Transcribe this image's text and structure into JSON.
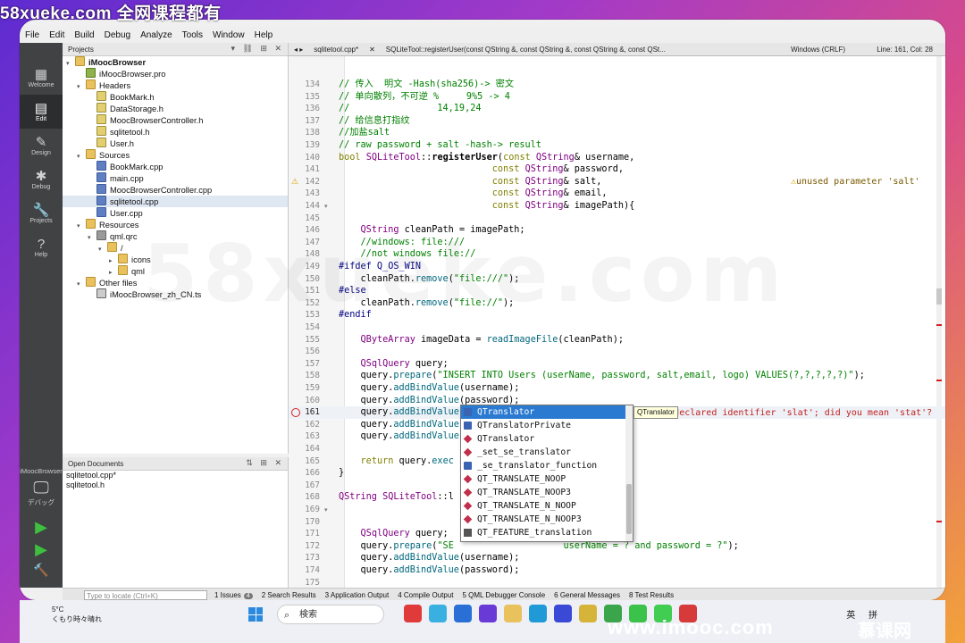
{
  "window": {
    "title": "sqlitetool.cpp @ iMoocBrowser - Qt Creator"
  },
  "watermarks": {
    "top_left": "58xueke.com  全网课程都有",
    "center": "58xueke.com",
    "bottom_right": "www.imooc.com",
    "bottom_right2": "慕课网"
  },
  "menu": [
    "File",
    "Edit",
    "Build",
    "Debug",
    "Analyze",
    "Tools",
    "Window",
    "Help"
  ],
  "modes": [
    {
      "label": "Welcome",
      "icon": "grid-icon"
    },
    {
      "label": "Edit",
      "icon": "edit-icon"
    },
    {
      "label": "Design",
      "icon": "pencil-icon"
    },
    {
      "label": "Debug",
      "icon": "bug-icon"
    },
    {
      "label": "Projects",
      "icon": "wrench-icon"
    },
    {
      "label": "Help",
      "icon": "help-icon"
    }
  ],
  "project_pane": {
    "title": "Projects",
    "tree": [
      {
        "label": "iMoocBrowser",
        "depth": 0,
        "icon": "project",
        "arrow": "▾",
        "bold": true
      },
      {
        "label": "iMoocBrowser.pro",
        "depth": 1,
        "icon": "pro",
        "arrow": ""
      },
      {
        "label": "Headers",
        "depth": 1,
        "icon": "folder",
        "arrow": "▾"
      },
      {
        "label": "BookMark.h",
        "depth": 2,
        "icon": "h",
        "arrow": ""
      },
      {
        "label": "DataStorage.h",
        "depth": 2,
        "icon": "h",
        "arrow": ""
      },
      {
        "label": "MoocBrowserController.h",
        "depth": 2,
        "icon": "h",
        "arrow": ""
      },
      {
        "label": "sqlitetool.h",
        "depth": 2,
        "icon": "h",
        "arrow": ""
      },
      {
        "label": "User.h",
        "depth": 2,
        "icon": "h",
        "arrow": ""
      },
      {
        "label": "Sources",
        "depth": 1,
        "icon": "folder",
        "arrow": "▾"
      },
      {
        "label": "BookMark.cpp",
        "depth": 2,
        "icon": "cpp",
        "arrow": ""
      },
      {
        "label": "main.cpp",
        "depth": 2,
        "icon": "cpp",
        "arrow": ""
      },
      {
        "label": "MoocBrowserController.cpp",
        "depth": 2,
        "icon": "cpp",
        "arrow": ""
      },
      {
        "label": "sqlitetool.cpp",
        "depth": 2,
        "icon": "cpp",
        "arrow": "",
        "selected": true
      },
      {
        "label": "User.cpp",
        "depth": 2,
        "icon": "cpp",
        "arrow": ""
      },
      {
        "label": "Resources",
        "depth": 1,
        "icon": "folder",
        "arrow": "▾"
      },
      {
        "label": "qml.qrc",
        "depth": 2,
        "icon": "qrc",
        "arrow": "▾"
      },
      {
        "label": "/",
        "depth": 3,
        "icon": "folder",
        "arrow": "▾"
      },
      {
        "label": "icons",
        "depth": 4,
        "icon": "folder",
        "arrow": "▸"
      },
      {
        "label": "qml",
        "depth": 4,
        "icon": "folder",
        "arrow": "▸"
      },
      {
        "label": "Other files",
        "depth": 1,
        "icon": "folder",
        "arrow": "▾"
      },
      {
        "label": "iMoocBrowser_zh_CN.ts",
        "depth": 2,
        "icon": "ts",
        "arrow": ""
      }
    ]
  },
  "open_docs": {
    "title": "Open Documents",
    "items": [
      "sqlitetool.cpp*",
      "sqlitetool.h"
    ]
  },
  "session": {
    "name": "iMoocBrowser",
    "kit_label": "デバッグ"
  },
  "editor_header": {
    "file_tab": "sqlitetool.cpp*",
    "symbol": "SQLiteTool::registerUser(const QString &, const QString &, const QString &, const QSt...",
    "encoding": "Windows (CRLF)",
    "position": "Line: 161, Col: 28"
  },
  "code": [
    {
      "n": 134,
      "html": "<span class='cm'>// 传入  明文 -Hash(sha256)-> 密文</span>"
    },
    {
      "n": 135,
      "html": "<span class='cm'>// 单向散列，不可逆 %     9%5 -> 4</span>"
    },
    {
      "n": 136,
      "html": "<span class='cm'>//                14,19,24</span>"
    },
    {
      "n": 137,
      "html": "<span class='cm'>// 给信息打指纹</span>"
    },
    {
      "n": 138,
      "html": "<span class='cm'>//加盐salt</span>"
    },
    {
      "n": 139,
      "html": "<span class='cm'>// raw password + salt -hash-> result</span>"
    },
    {
      "n": 140,
      "html": "<span class='kw'>bool</span> <span class='ty'>SQLiteTool</span>::<span class='bold'>registerUser</span>(<span class='kw'>const</span> <span class='ty'>QString</span>&amp; username,"
    },
    {
      "n": 141,
      "html": "                            <span class='kw'>const</span> <span class='ty'>QString</span>&amp; password,"
    },
    {
      "n": 142,
      "html": "                            <span class='kw'>const</span> <span class='ty'>QString</span>&amp; salt,",
      "warn": true
    },
    {
      "n": 143,
      "html": "                            <span class='kw'>const</span> <span class='ty'>QString</span>&amp; email,"
    },
    {
      "n": 144,
      "html": "                            <span class='kw'>const</span> <span class='ty'>QString</span>&amp; imagePath){",
      "fold": true
    },
    {
      "n": 145,
      "html": ""
    },
    {
      "n": 146,
      "html": "    <span class='ty'>QString</span> cleanPath = imagePath;"
    },
    {
      "n": 147,
      "html": "    <span class='cm'>//windows: file:///</span>"
    },
    {
      "n": 148,
      "html": "    <span class='cm'>//not windows file://</span>"
    },
    {
      "n": 149,
      "html": "<span class='pp'>#ifdef Q_OS_WIN</span>"
    },
    {
      "n": 150,
      "html": "    cleanPath.<span class='fn'>remove</span>(<span class='st'>\"file:///\"</span>);"
    },
    {
      "n": 151,
      "html": "<span class='pp'>#else</span>"
    },
    {
      "n": 152,
      "html": "    cleanPath.<span class='fn'>remove</span>(<span class='st'>\"file://\"</span>);"
    },
    {
      "n": 153,
      "html": "<span class='pp'>#endif</span>"
    },
    {
      "n": 154,
      "html": ""
    },
    {
      "n": 155,
      "html": "    <span class='ty'>QByteArray</span> imageData = <span class='fn'>readImageFile</span>(cleanPath);"
    },
    {
      "n": 156,
      "html": ""
    },
    {
      "n": 157,
      "html": "    <span class='ty'>QSqlQuery</span> query;"
    },
    {
      "n": 158,
      "html": "    query.<span class='fn'>prepare</span>(<span class='st'>\"INSERT INTO Users (userName, password, salt,email, logo) VALUES(?,?,?,?,?)\"</span>);"
    },
    {
      "n": 159,
      "html": "    query.<span class='fn'>addBindValue</span>(username);"
    },
    {
      "n": 160,
      "html": "    query.<span class='fn'>addBindValue</span>(password);"
    },
    {
      "n": 161,
      "html": "    query.<span class='fn'>addBindValue</span>(slat;",
      "err": true,
      "current": true
    },
    {
      "n": 162,
      "html": "    query.<span class='fn'>addBindValue</span>"
    },
    {
      "n": 163,
      "html": "    query.<span class='fn'>addBindValue</span>"
    },
    {
      "n": 164,
      "html": ""
    },
    {
      "n": 165,
      "html": "    <span class='kw'>return</span> query.<span class='fn'>exec</span>"
    },
    {
      "n": 166,
      "html": "}"
    },
    {
      "n": 167,
      "html": ""
    },
    {
      "n": 168,
      "html": "<span class='ty'>QString</span> <span class='ty'>SQLiteTool</span>::l                        me,"
    },
    {
      "n": 169,
      "html": "                                              rd){",
      "fold": true
    },
    {
      "n": 170,
      "html": ""
    },
    {
      "n": 171,
      "html": "    <span class='ty'>QSqlQuery</span> query;"
    },
    {
      "n": 172,
      "html": "    query.<span class='fn'>prepare</span>(<span class='st'>\"SE                    userName = ? and password = ?\"</span>);"
    },
    {
      "n": 173,
      "html": "    query.<span class='fn'>addBindValue</span>(username);"
    },
    {
      "n": 174,
      "html": "    query.<span class='fn'>addBindValue</span>(password);"
    },
    {
      "n": 175,
      "html": ""
    }
  ],
  "annotations": {
    "warning": "unused parameter 'salt'",
    "error": "use of undeclared identifier 'slat'; did you mean 'stat'?"
  },
  "completion": {
    "items": [
      {
        "label": "QTranslator",
        "kind": "class",
        "selected": true
      },
      {
        "label": "QTranslatorPrivate",
        "kind": "class"
      },
      {
        "label": "QTranslator",
        "kind": "func"
      },
      {
        "label": "_set_se_translator",
        "kind": "func"
      },
      {
        "label": "_se_translator_function",
        "kind": "class"
      },
      {
        "label": "QT_TRANSLATE_NOOP",
        "kind": "func"
      },
      {
        "label": "QT_TRANSLATE_NOOP3",
        "kind": "func"
      },
      {
        "label": "QT_TRANSLATE_N_NOOP",
        "kind": "func"
      },
      {
        "label": "QT_TRANSLATE_N_NOOP3",
        "kind": "func"
      },
      {
        "label": "QT_FEATURE_translation",
        "kind": "enum"
      }
    ],
    "tooltip": "QTranslator"
  },
  "statusbar": {
    "locate_placeholder": "Type to locate (Ctrl+K)",
    "panes": [
      {
        "label": "1 Issues",
        "badge": "4"
      },
      {
        "label": "2 Search Results"
      },
      {
        "label": "3 Application Output"
      },
      {
        "label": "4 Compile Output"
      },
      {
        "label": "5 QML Debugger Console"
      },
      {
        "label": "6 General Messages"
      },
      {
        "label": "8 Test Results"
      }
    ]
  },
  "taskbar": {
    "weather_temp": "5°C",
    "weather_desc": "くもり時々晴れ",
    "search_label": "検索",
    "tray": "英 拼"
  },
  "colors": {
    "accent": "#2b7ad1",
    "error": "#d62020",
    "warning": "#d9a400"
  }
}
